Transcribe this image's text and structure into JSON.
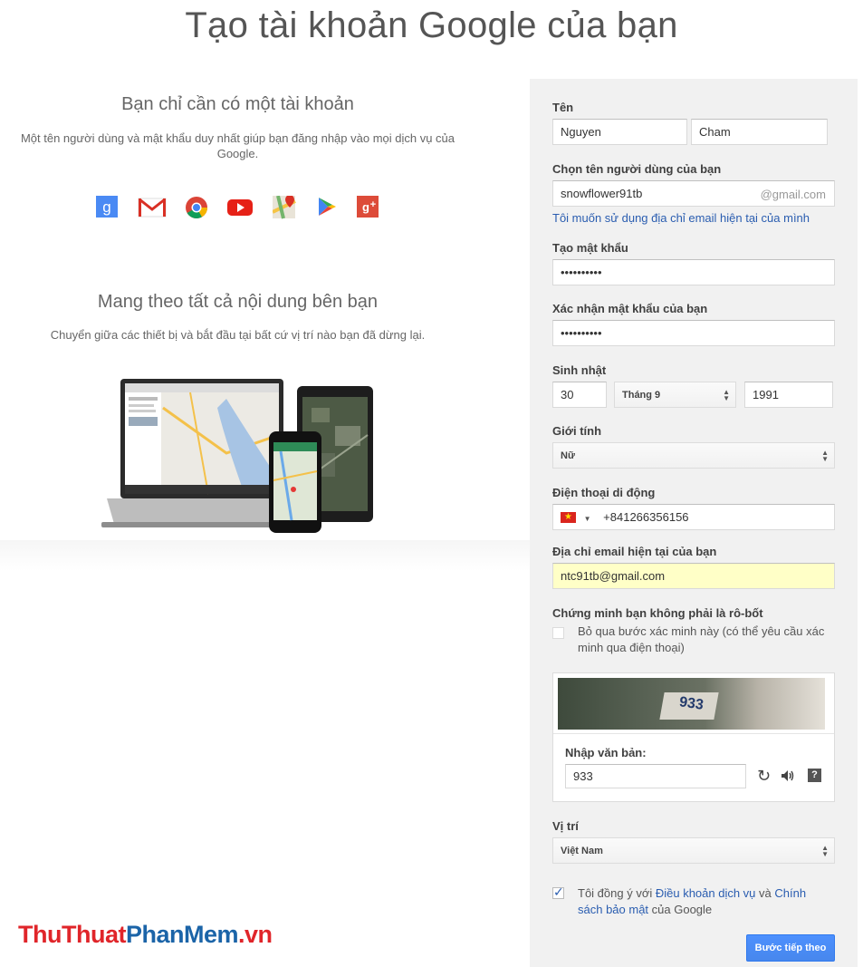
{
  "page": {
    "title": "Tạo tài khoản Google của bạn"
  },
  "intro": {
    "heading": "Bạn chỉ cần có một tài khoản",
    "description_line1": "Một tên người dùng và mật khẩu duy nhất giúp bạn đăng nhập vào mọi dịch vụ của",
    "description_line2": "Google.",
    "services": [
      "google-search-icon",
      "gmail-icon",
      "chrome-icon",
      "youtube-icon",
      "maps-icon",
      "play-icon",
      "google-plus-icon"
    ]
  },
  "devices_section": {
    "heading": "Mang theo tất cả nội dung bên bạn",
    "description": "Chuyển giữa các thiết bị và bắt đầu tại bất cứ vị trí nào bạn đã dừng lại."
  },
  "form": {
    "name": {
      "label": "Tên",
      "first": "Nguyen",
      "last": "Cham"
    },
    "username": {
      "label": "Chọn tên người dùng của bạn",
      "value": "snowflower91tb",
      "suffix": "@gmail.com",
      "alt_link": "Tôi muốn sử dụng địa chỉ email hiện tại của mình"
    },
    "password": {
      "label": "Tạo mật khẩu",
      "value": "••••••••••"
    },
    "confirm_password": {
      "label": "Xác nhận mật khẩu của bạn",
      "value": "••••••••••"
    },
    "birthday": {
      "label": "Sinh nhật",
      "day": "30",
      "month": "Tháng 9",
      "year": "1991"
    },
    "gender": {
      "label": "Giới tính",
      "value": "Nữ"
    },
    "phone": {
      "label": "Điện thoại di động",
      "value": "+841266356156",
      "country_flag": "vietnam-flag-icon"
    },
    "current_email": {
      "label": "Địa chỉ email hiện tại của bạn",
      "value": "ntc91tb@gmail.com",
      "highlight_color": "#ffffc7"
    },
    "robot": {
      "label": "Chứng minh bạn không phải là rô-bốt",
      "skip_line1": "Bỏ qua bước xác minh này (có thể yêu cầu xác",
      "skip_line2": "minh qua điện thoại)"
    },
    "captcha": {
      "image_text": "933",
      "input_label": "Nhập văn bản:",
      "input_value": "933"
    },
    "location": {
      "label": "Vị trí",
      "value": "Việt Nam"
    },
    "terms": {
      "prefix": "Tôi đồng ý với ",
      "tos_link": "Điều khoản dịch vụ",
      "and": " và ",
      "privacy_link_1": "Chính",
      "privacy_link_2": "sách bảo mật",
      "suffix": " của Google"
    },
    "next_button": "Bước tiếp theo"
  },
  "watermark": {
    "part1": "ThuThuat",
    "part2": "PhanMem",
    "part3": ".vn"
  },
  "colors": {
    "accent": "#4d90fe",
    "link": "#2a5db0",
    "panel_bg": "#f1f1f1"
  }
}
